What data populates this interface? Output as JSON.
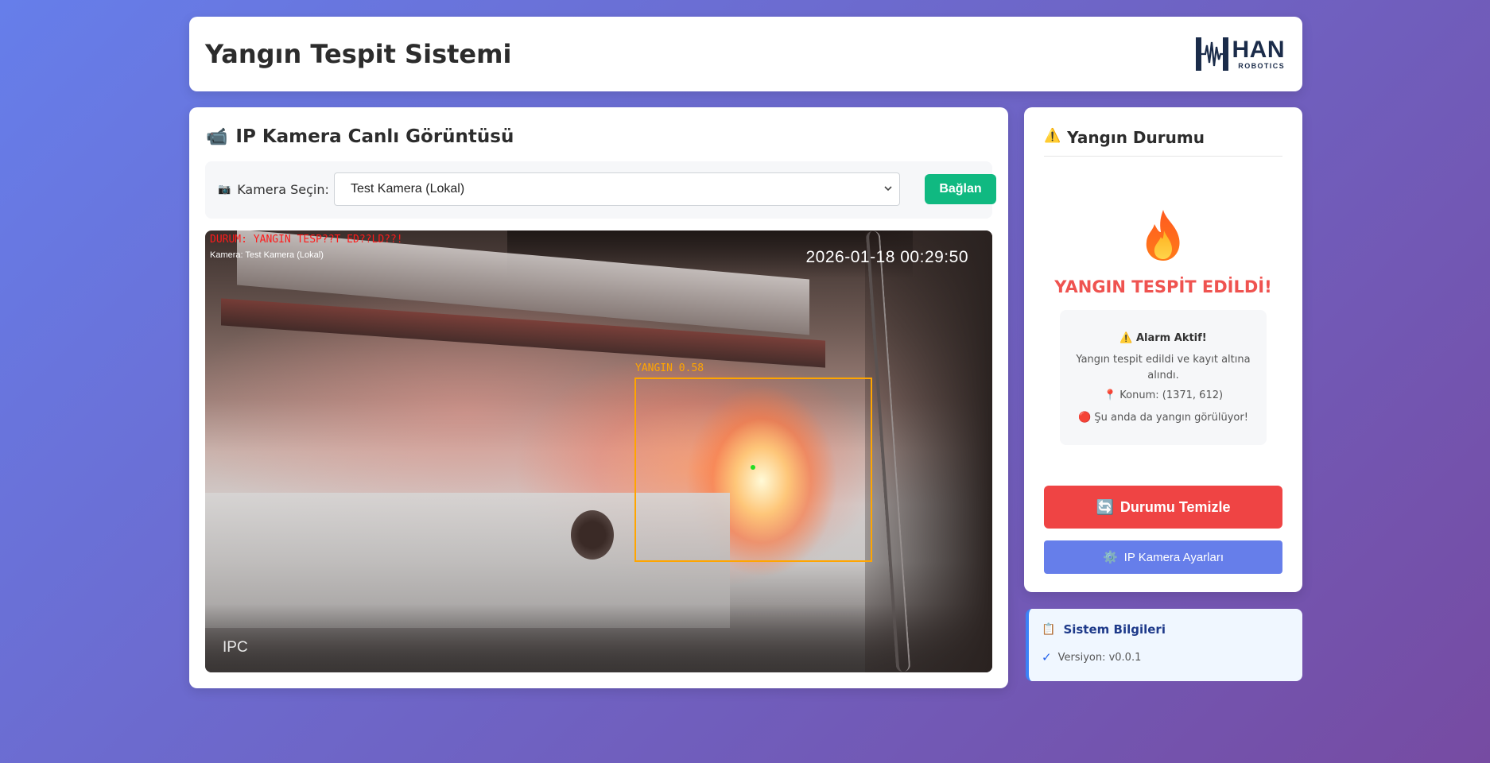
{
  "header": {
    "title": "Yangın Tespit Sistemi",
    "logo": {
      "wordmark": "HAN",
      "subtext": "ROBOTICS"
    }
  },
  "camera_panel": {
    "icon": "camera-icon",
    "title": "IP Kamera Canlı Görüntüsü",
    "select_label_icon": "camera-icon",
    "select_label": "Kamera Seçin:",
    "selected_camera": "Test Kamera (Lokal)",
    "connect_button": "Bağlan",
    "overlay": {
      "status_text": "DURUM: YANGIN TESP??T ED??LD??!",
      "camera_text": "Kamera: Test Kamera (Lokal)",
      "timestamp": "2026-01-18 00:29:50",
      "watermark": "IPC",
      "detection_label": "YANGIN 0.58",
      "detection_confidence": 0.58,
      "detection_color": "#ffa500"
    }
  },
  "fire_status": {
    "icon": "warning-icon",
    "title": "Yangın Durumu",
    "state_icon": "fire-icon",
    "state_text": "YANGIN TESPİT EDİLDİ!",
    "state_color": "#ef5350",
    "alarm": {
      "icon": "warning-icon",
      "title": "Alarm Aktif!",
      "description": "Yangın tespit edildi ve kayıt altına alındı.",
      "location_icon": "pin-icon",
      "location": "Konum: (1371, 612)",
      "live_icon": "red-circle-icon",
      "live_text": "Şu anda da yangın görülüyor!"
    },
    "clear_button": {
      "icon": "refresh-icon",
      "label": "Durumu Temizle",
      "color": "#ef4444"
    },
    "settings_button": {
      "icon": "gear-icon",
      "label": "IP Kamera Ayarları",
      "color": "#667eea"
    }
  },
  "system_info": {
    "icon": "clipboard-icon",
    "title": "Sistem Bilgileri",
    "items": [
      {
        "icon": "check-icon",
        "text": "Versiyon: v0.0.1"
      }
    ]
  },
  "colors": {
    "background_start": "#667eea",
    "background_end": "#764ba2",
    "connect_button": "#10b981"
  }
}
